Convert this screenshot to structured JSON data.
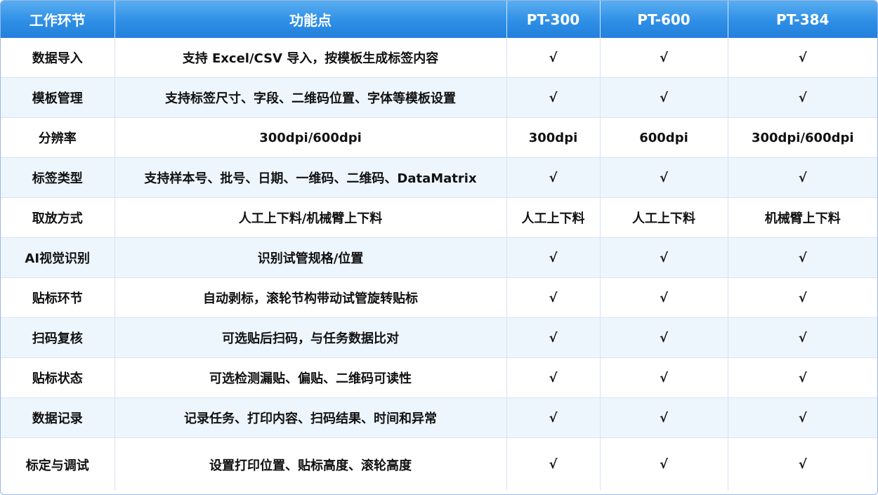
{
  "header": [
    "工作环节",
    "功能点",
    "PT-300",
    "PT-600",
    "PT-384"
  ],
  "rows": [
    [
      "数据导入",
      "支持 Excel/CSV 导入，按模板生成标签内容",
      "√",
      "√",
      "√"
    ],
    [
      "模板管理",
      "支持标签尺寸、字段、二维码位置、字体等模板设置",
      "√",
      "√",
      "√"
    ],
    [
      "分辨率",
      "300dpi/600dpi",
      "300dpi",
      "600dpi",
      "300dpi/600dpi"
    ],
    [
      "标签类型",
      "支持样本号、批号、日期、一维码、二维码、DataMatrix",
      "√",
      "√",
      "√"
    ],
    [
      "取放方式",
      "人工上下料/机械臂上下料",
      "人工上下料",
      "人工上下料",
      "机械臂上下料"
    ],
    [
      "AI视觉识别",
      "识别试管规格/位置",
      "√",
      "√",
      "√"
    ],
    [
      "贴标环节",
      "自动剥标，滚轮节构带动试管旋转贴标",
      "√",
      "√",
      "√"
    ],
    [
      "扫码复核",
      "可选贴后扫码，与任务数据比对",
      "√",
      "√",
      "√"
    ],
    [
      "贴标状态",
      "可选检测漏贴、偏贴、二维码可读性",
      "√",
      "√",
      "√"
    ],
    [
      "数据记录",
      "记录任务、打印内容、扫码结果、时间和异常",
      "√",
      "√",
      "√"
    ],
    [
      "标定与调试",
      "设置打印位置、贴标高度、滚轮高度",
      "√",
      "√",
      "√"
    ]
  ],
  "colors": {
    "header_top": "#5aaef0",
    "header_bottom": "#237fdc",
    "row_tint": "#eef6fd",
    "grid": "#d9e4f2"
  }
}
